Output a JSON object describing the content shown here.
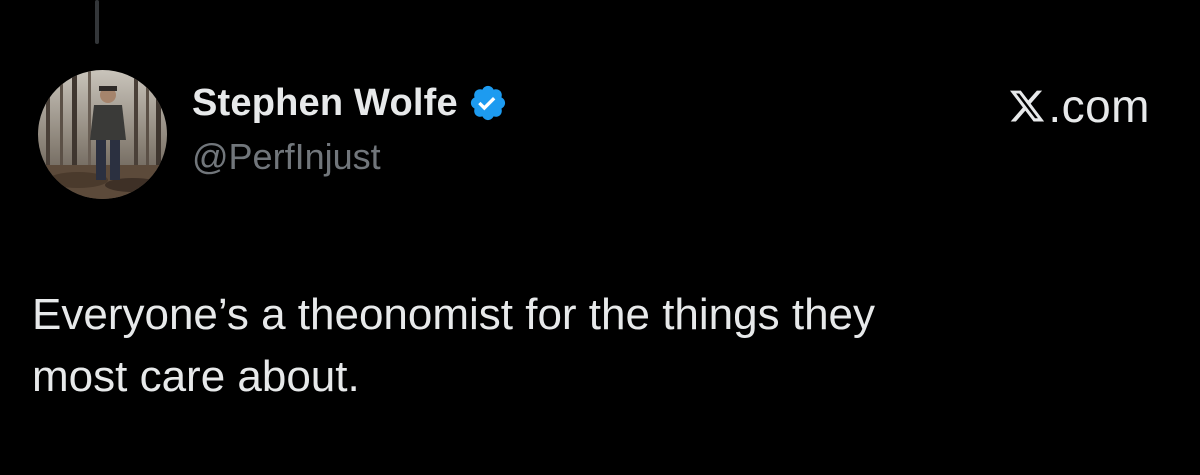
{
  "author": {
    "display_name": "Stephen Wolfe",
    "handle": "@PerfInjust",
    "verified": true,
    "avatar_icon": "profile-photo-man-in-woods"
  },
  "brand": {
    "label": ".com",
    "icon": "x-logo-icon"
  },
  "tweet": {
    "text": "Everyone’s a theonomist for the things they\nmost care about."
  },
  "colors": {
    "background": "#000000",
    "primary_text": "#e7e9ea",
    "secondary_text": "#71767b",
    "verified_blue": "#1d9bf0"
  }
}
